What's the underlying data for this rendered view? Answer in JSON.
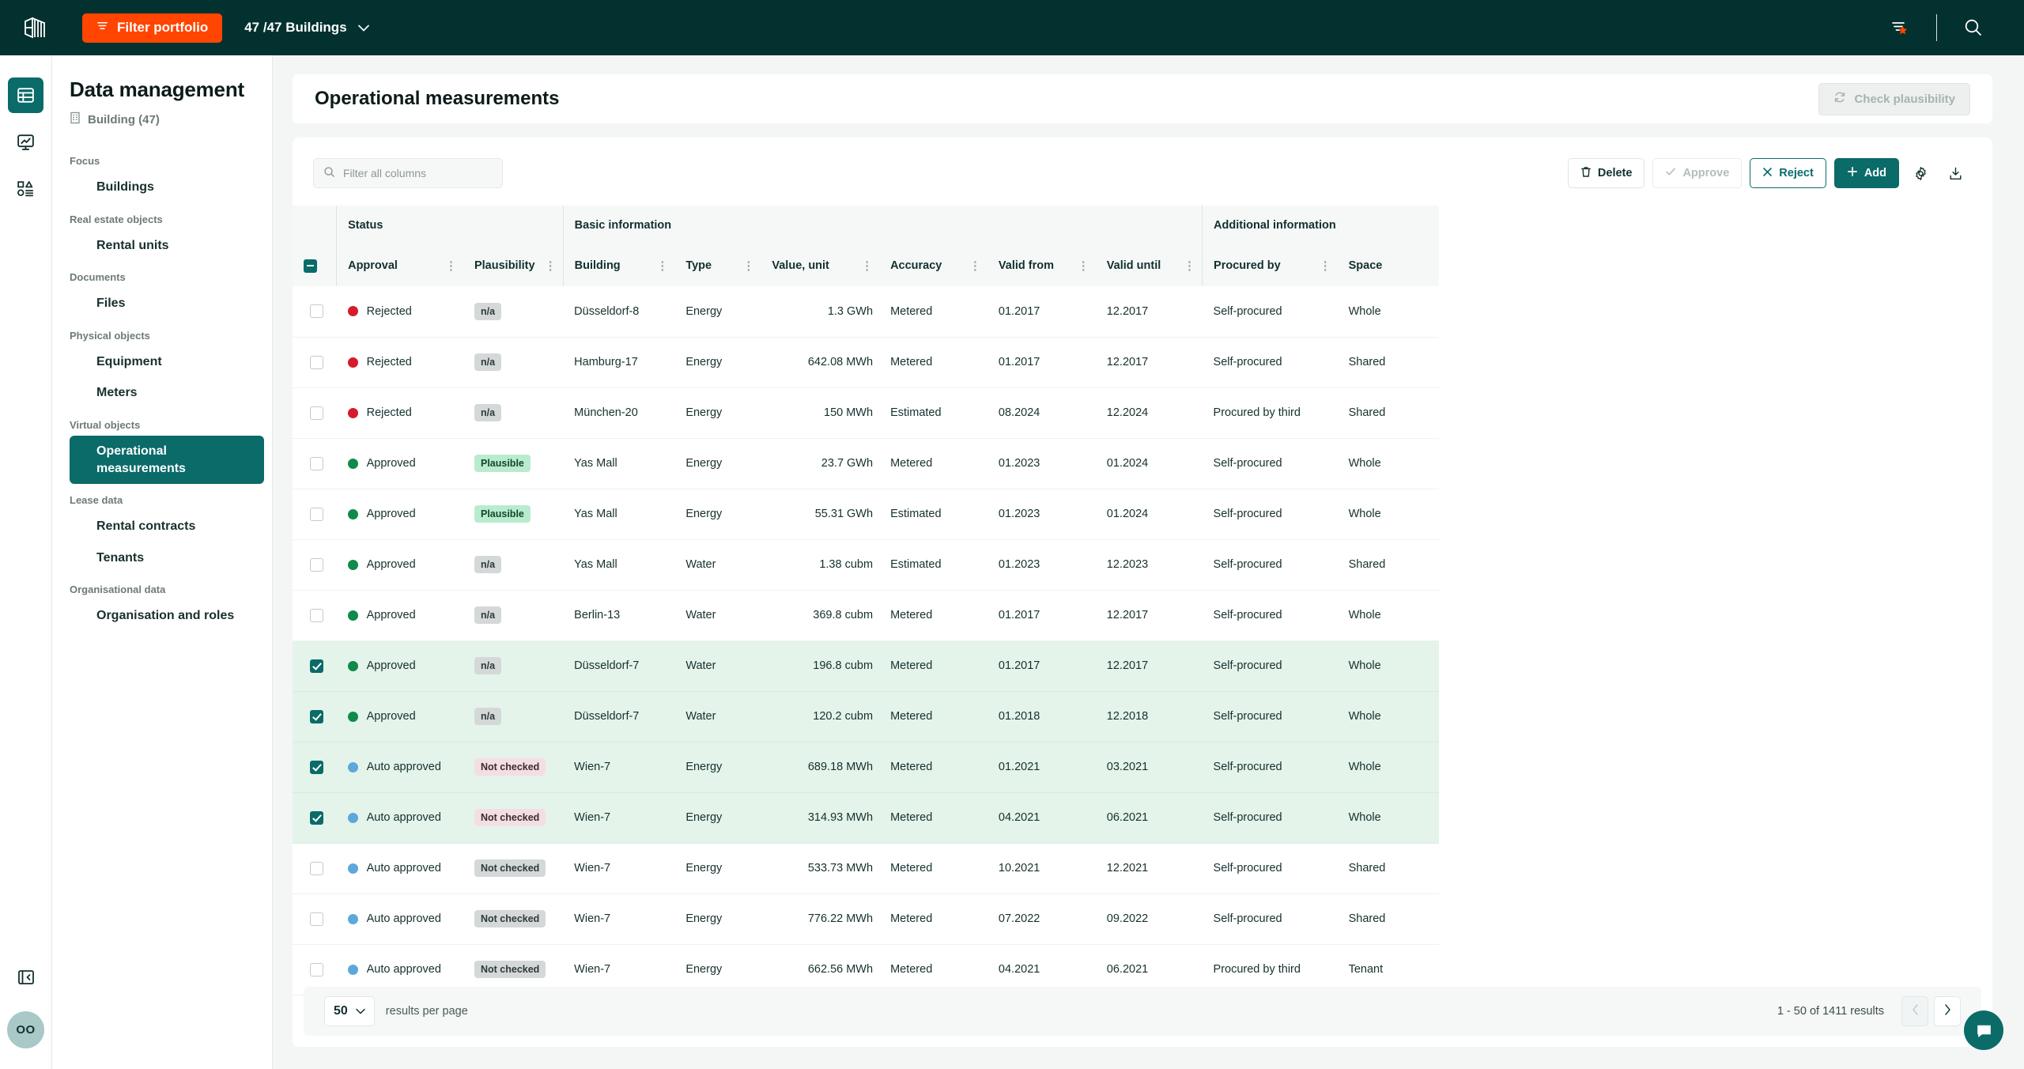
{
  "topbar": {
    "logo_icon": "building-logo-icon",
    "filter_portfolio_label": "Filter portfolio",
    "filter_icon": "filter-icon",
    "buildings_selector": "47 /47 Buildings",
    "chevron_icon": "chevron-down-icon",
    "saved_filter_icon": "filter-star-icon",
    "search_icon": "search-icon"
  },
  "rail": {
    "items": [
      {
        "name": "table-view",
        "icon": "table-icon",
        "active": true
      },
      {
        "name": "dashboard",
        "icon": "monitor-chart-icon",
        "active": false
      },
      {
        "name": "modules",
        "icon": "shapes-icon",
        "active": false
      }
    ],
    "collapse_icon": "collapse-panel-icon",
    "avatar_initials": "OO"
  },
  "sidebar": {
    "title": "Data management",
    "subtitle": "Building (47)",
    "subtitle_icon": "building-icon",
    "nav": [
      {
        "group": "Focus",
        "items": [
          {
            "label": "Buildings",
            "active": false
          }
        ]
      },
      {
        "group": "Real estate objects",
        "items": [
          {
            "label": "Rental units",
            "active": false
          }
        ]
      },
      {
        "group": "Documents",
        "items": [
          {
            "label": "Files",
            "active": false
          }
        ]
      },
      {
        "group": "Physical objects",
        "items": [
          {
            "label": "Equipment",
            "active": false
          },
          {
            "label": "Meters",
            "active": false
          }
        ]
      },
      {
        "group": "Virtual objects",
        "items": [
          {
            "label": "Operational measurements",
            "active": true
          }
        ]
      },
      {
        "group": "Lease data",
        "items": [
          {
            "label": "Rental contracts",
            "active": false
          },
          {
            "label": "Tenants",
            "active": false
          }
        ]
      },
      {
        "group": "Organisational data",
        "items": [
          {
            "label": "Organisation and roles",
            "active": false
          }
        ]
      }
    ]
  },
  "page": {
    "title": "Operational measurements",
    "check_plausibility_label": "Check plausibility",
    "check_plausibility_icon": "refresh-icon",
    "check_plausibility_disabled": true
  },
  "toolbar": {
    "search_placeholder": "Filter all columns",
    "search_value": "",
    "search_icon": "search-icon",
    "delete_label": "Delete",
    "delete_icon": "trash-icon",
    "approve_label": "Approve",
    "approve_icon": "check-icon",
    "approve_disabled": true,
    "reject_label": "Reject",
    "reject_icon": "close-icon",
    "add_label": "Add",
    "add_icon": "plus-icon",
    "settings_icon": "gear-icon",
    "download_icon": "download-icon"
  },
  "table": {
    "group_headers": [
      {
        "label": "Status",
        "span": 2
      },
      {
        "label": "Basic information",
        "span": 6
      },
      {
        "label": "Additional information",
        "span": 2
      }
    ],
    "columns": [
      {
        "key": "approval",
        "label": "Approval",
        "align": "left"
      },
      {
        "key": "plausibility",
        "label": "Plausibility",
        "align": "left"
      },
      {
        "key": "building",
        "label": "Building",
        "align": "left"
      },
      {
        "key": "type",
        "label": "Type",
        "align": "left"
      },
      {
        "key": "value",
        "label": "Value, unit",
        "align": "right"
      },
      {
        "key": "accuracy",
        "label": "Accuracy",
        "align": "left"
      },
      {
        "key": "valid_from",
        "label": "Valid from",
        "align": "left"
      },
      {
        "key": "valid_until",
        "label": "Valid until",
        "align": "left"
      },
      {
        "key": "procured_by",
        "label": "Procured by",
        "align": "left"
      },
      {
        "key": "space",
        "label": "Space",
        "align": "left"
      }
    ],
    "header_checkbox_state": "indeterminate",
    "rows": [
      {
        "selected": false,
        "approval": "Rejected",
        "status_color": "#d61b2b",
        "plausibility": "n/a",
        "plaus_style": "gray",
        "building": "Düsseldorf-8",
        "type": "Energy",
        "value": "1.3 GWh",
        "accuracy": "Metered",
        "valid_from": "01.2017",
        "valid_until": "12.2017",
        "procured_by": "Self-procured",
        "space": "Whole"
      },
      {
        "selected": false,
        "approval": "Rejected",
        "status_color": "#d61b2b",
        "plausibility": "n/a",
        "plaus_style": "gray",
        "building": "Hamburg-17",
        "type": "Energy",
        "value": "642.08 MWh",
        "accuracy": "Metered",
        "valid_from": "01.2017",
        "valid_until": "12.2017",
        "procured_by": "Self-procured",
        "space": "Shared"
      },
      {
        "selected": false,
        "approval": "Rejected",
        "status_color": "#d61b2b",
        "plausibility": "n/a",
        "plaus_style": "gray",
        "building": "München-20",
        "type": "Energy",
        "value": "150 MWh",
        "accuracy": "Estimated",
        "valid_from": "08.2024",
        "valid_until": "12.2024",
        "procured_by": "Procured by third",
        "space": "Shared"
      },
      {
        "selected": false,
        "approval": "Approved",
        "status_color": "#0f8a4a",
        "plausibility": "Plausible",
        "plaus_style": "green",
        "building": "Yas Mall",
        "type": "Energy",
        "value": "23.7 GWh",
        "accuracy": "Metered",
        "valid_from": "01.2023",
        "valid_until": "01.2024",
        "procured_by": "Self-procured",
        "space": "Whole"
      },
      {
        "selected": false,
        "approval": "Approved",
        "status_color": "#0f8a4a",
        "plausibility": "Plausible",
        "plaus_style": "green",
        "building": "Yas Mall",
        "type": "Energy",
        "value": "55.31 GWh",
        "accuracy": "Estimated",
        "valid_from": "01.2023",
        "valid_until": "01.2024",
        "procured_by": "Self-procured",
        "space": "Whole"
      },
      {
        "selected": false,
        "approval": "Approved",
        "status_color": "#0f8a4a",
        "plausibility": "n/a",
        "plaus_style": "gray",
        "building": "Yas Mall",
        "type": "Water",
        "value": "1.38 cubm",
        "accuracy": "Estimated",
        "valid_from": "01.2023",
        "valid_until": "12.2023",
        "procured_by": "Self-procured",
        "space": "Shared"
      },
      {
        "selected": false,
        "approval": "Approved",
        "status_color": "#0f8a4a",
        "plausibility": "n/a",
        "plaus_style": "gray",
        "building": "Berlin-13",
        "type": "Water",
        "value": "369.8 cubm",
        "accuracy": "Metered",
        "valid_from": "01.2017",
        "valid_until": "12.2017",
        "procured_by": "Self-procured",
        "space": "Whole"
      },
      {
        "selected": true,
        "approval": "Approved",
        "status_color": "#0f8a4a",
        "plausibility": "n/a",
        "plaus_style": "gray",
        "building": "Düsseldorf-7",
        "type": "Water",
        "value": "196.8 cubm",
        "accuracy": "Metered",
        "valid_from": "01.2017",
        "valid_until": "12.2017",
        "procured_by": "Self-procured",
        "space": "Whole"
      },
      {
        "selected": true,
        "approval": "Approved",
        "status_color": "#0f8a4a",
        "plausibility": "n/a",
        "plaus_style": "gray",
        "building": "Düsseldorf-7",
        "type": "Water",
        "value": "120.2 cubm",
        "accuracy": "Metered",
        "valid_from": "01.2018",
        "valid_until": "12.2018",
        "procured_by": "Self-procured",
        "space": "Whole"
      },
      {
        "selected": true,
        "approval": "Auto approved",
        "status_color": "#5da8da",
        "plausibility": "Not checked",
        "plaus_style": "pink",
        "building": "Wien-7",
        "type": "Energy",
        "value": "689.18 MWh",
        "accuracy": "Metered",
        "valid_from": "01.2021",
        "valid_until": "03.2021",
        "procured_by": "Self-procured",
        "space": "Whole"
      },
      {
        "selected": true,
        "approval": "Auto approved",
        "status_color": "#5da8da",
        "plausibility": "Not checked",
        "plaus_style": "pink",
        "building": "Wien-7",
        "type": "Energy",
        "value": "314.93 MWh",
        "accuracy": "Metered",
        "valid_from": "04.2021",
        "valid_until": "06.2021",
        "procured_by": "Self-procured",
        "space": "Whole"
      },
      {
        "selected": false,
        "approval": "Auto approved",
        "status_color": "#5da8da",
        "plausibility": "Not checked",
        "plaus_style": "gray",
        "building": "Wien-7",
        "type": "Energy",
        "value": "533.73 MWh",
        "accuracy": "Metered",
        "valid_from": "10.2021",
        "valid_until": "12.2021",
        "procured_by": "Self-procured",
        "space": "Shared"
      },
      {
        "selected": false,
        "approval": "Auto approved",
        "status_color": "#5da8da",
        "plausibility": "Not checked",
        "plaus_style": "gray",
        "building": "Wien-7",
        "type": "Energy",
        "value": "776.22 MWh",
        "accuracy": "Metered",
        "valid_from": "07.2022",
        "valid_until": "09.2022",
        "procured_by": "Self-procured",
        "space": "Shared"
      },
      {
        "selected": false,
        "approval": "Auto approved",
        "status_color": "#5da8da",
        "plausibility": "Not checked",
        "plaus_style": "gray",
        "building": "Wien-7",
        "type": "Energy",
        "value": "662.56 MWh",
        "accuracy": "Metered",
        "valid_from": "04.2021",
        "valid_until": "06.2021",
        "procured_by": "Procured by third",
        "space": "Tenant"
      }
    ]
  },
  "footer": {
    "results_per_page_value": "50",
    "results_per_page_label": "results per page",
    "chevron_icon": "chevron-down-icon",
    "range_text": "1 - 50 of 1411 results",
    "prev_icon": "chevron-left-icon",
    "next_icon": "chevron-right-icon",
    "prev_disabled": true
  },
  "chat": {
    "icon": "chat-bubble-icon"
  },
  "colors": {
    "brand_dark": "#03312f",
    "accent_orange": "#ff4500",
    "teal": "#0a6b69",
    "selected_row": "#e4f4ea",
    "rejected": "#d61b2b",
    "approved": "#0f8a4a",
    "auto_approved": "#5da8da"
  }
}
